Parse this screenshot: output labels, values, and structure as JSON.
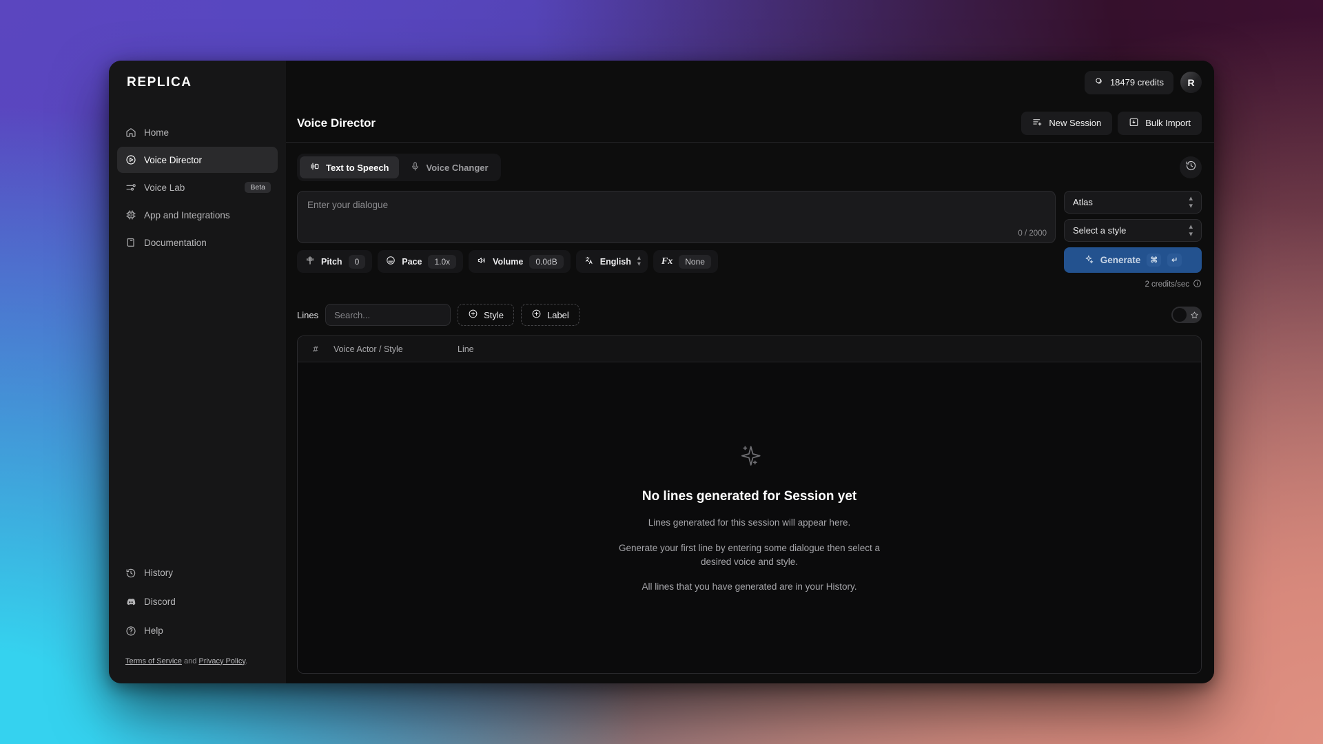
{
  "sidebar": {
    "logo": "REPLICA",
    "items": [
      {
        "label": "Home",
        "icon": "home-icon"
      },
      {
        "label": "Voice Director",
        "icon": "play-circle-icon"
      },
      {
        "label": "Voice Lab",
        "icon": "sliders-icon",
        "badge": "Beta"
      },
      {
        "label": "App and Integrations",
        "icon": "chip-icon"
      },
      {
        "label": "Documentation",
        "icon": "book-icon"
      }
    ],
    "bottom_items": [
      {
        "label": "History",
        "icon": "history-icon"
      },
      {
        "label": "Discord",
        "icon": "discord-icon"
      },
      {
        "label": "Help",
        "icon": "help-circle-icon"
      }
    ],
    "legal": {
      "terms": "Terms of Service",
      "and": " and ",
      "privacy": "Privacy Policy",
      "period": "."
    }
  },
  "topbar": {
    "credits": "18479 credits",
    "credits_icon": "coins-icon",
    "avatar_initial": "R"
  },
  "header": {
    "title": "Voice Director",
    "new_session": "New Session",
    "bulk_import": "Bulk Import"
  },
  "tabs": [
    {
      "label": "Text to Speech",
      "icon": "speech-icon",
      "active": true
    },
    {
      "label": "Voice Changer",
      "icon": "microphone-icon",
      "active": false
    }
  ],
  "history_icon": "history-clock-icon",
  "composer": {
    "placeholder": "Enter your dialogue",
    "value": "",
    "char_count": "0 / 2000",
    "controls": [
      {
        "label": "Pitch",
        "value": "0",
        "icon": "pitch-icon",
        "value_style": "chip"
      },
      {
        "label": "Pace",
        "value": "1.0x",
        "icon": "pace-icon",
        "value_style": "chip"
      },
      {
        "label": "Volume",
        "value": "0.0dB",
        "icon": "volume-icon",
        "value_style": "chip"
      },
      {
        "label": "English",
        "value": "",
        "icon": "translate-icon",
        "value_style": "chevron"
      },
      {
        "label": "Fx",
        "value": "None",
        "icon": "fx-text",
        "value_style": "chip"
      }
    ]
  },
  "right_panel": {
    "voice_select": "Atlas",
    "style_select": "Select a style",
    "generate_label": "Generate",
    "generate_kbd_1": "⌘",
    "generate_kbd_2": "↵",
    "credits_rate": "2 credits/sec",
    "info_icon": "info-icon"
  },
  "lines_toolbar": {
    "label": "Lines",
    "search_placeholder": "Search...",
    "search_value": "",
    "style_button": "Style",
    "label_button": "Label",
    "favorite_toggle_icon": "star-icon",
    "favorite_toggle_on": false
  },
  "table": {
    "columns": [
      "#",
      "Voice Actor / Style",
      "Line"
    ],
    "rows": [],
    "empty": {
      "icon": "sparkle-icon",
      "title": "No lines generated for Session yet",
      "paragraphs": [
        "Lines generated for this session will appear here.",
        "Generate your first line by entering some dialogue then select a desired voice and style.",
        "All lines that you have generated are in your History."
      ]
    }
  },
  "colors": {
    "accent_generate": "#23528f",
    "window_bg": "#0d0d0d",
    "sidebar_bg": "#161617",
    "active_nav": "#2a2a2c",
    "backdrop_topleft": "#5847c0",
    "backdrop_topright": "#35102c",
    "backdrop_bottomleft": "#35d2ef",
    "backdrop_bottomright": "#d8897c"
  }
}
